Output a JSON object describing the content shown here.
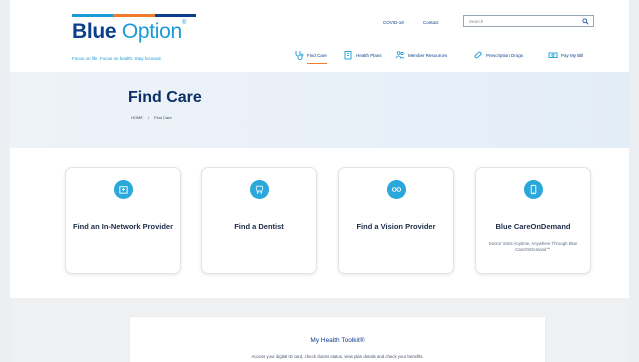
{
  "header": {
    "logo": {
      "brand_bold": "Blue",
      "brand_light": "Option",
      "trademark": "®",
      "tagline": "Focus on life. Focus on health. Stay focused."
    },
    "logo_bar_colors": [
      "#1a9ad6",
      "#f07c2c",
      "#0b3f8c"
    ],
    "top_links": {
      "covid": "COVID-19",
      "contact": "Contact"
    },
    "search": {
      "placeholder": "Search"
    },
    "nav": [
      {
        "label": "Find Care",
        "icon": "stethoscope-icon",
        "active": true
      },
      {
        "label": "Health Plans",
        "icon": "building-icon"
      },
      {
        "label": "Member Resources",
        "icon": "people-icon"
      },
      {
        "label": "Prescription Drugs",
        "icon": "pill-icon"
      },
      {
        "label": "Pay My Bill",
        "icon": "money-icon"
      }
    ]
  },
  "hero": {
    "title": "Find Care",
    "breadcrumb": {
      "home": "HOME",
      "separator": "/",
      "current": "Find Care"
    }
  },
  "cards": [
    {
      "title": "Find an In-Network Provider",
      "icon": "hospital-icon",
      "desc": ""
    },
    {
      "title": "Find a Dentist",
      "icon": "tooth-icon",
      "desc": ""
    },
    {
      "title": "Find a Vision Provider",
      "icon": "glasses-icon",
      "desc": ""
    },
    {
      "title": "Blue CareOnDemand",
      "icon": "phone-icon",
      "desc": "Doctor Visits Anytime, Anywhere Through Blue CareOnDemand℠"
    }
  ],
  "toolkit": {
    "title": "My Health Toolkit®",
    "text": "Access your digital ID card, check claims status, view plan details and check your benefits."
  },
  "colors": {
    "brand_dark": "#0b3f8c",
    "brand_light": "#1a9ad6",
    "accent": "#f07c2c",
    "icon_circle": "#2aa8dc"
  }
}
